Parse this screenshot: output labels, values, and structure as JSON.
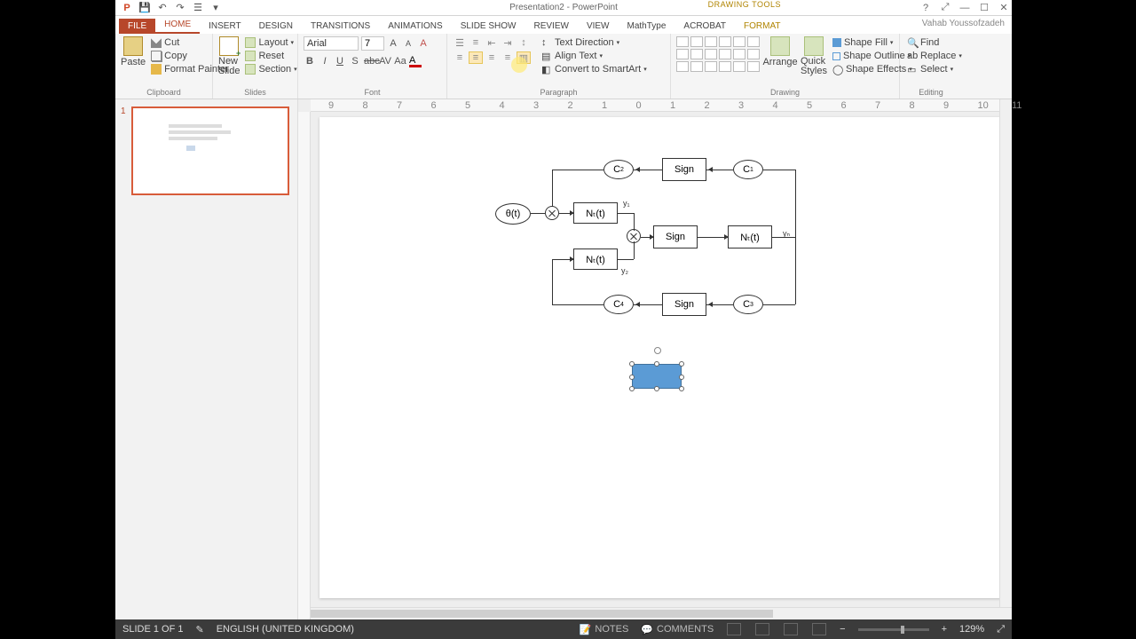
{
  "titlebar": {
    "title": "Presentation2 - PowerPoint",
    "context_tool": "DRAWING TOOLS"
  },
  "tabs": {
    "file": "FILE",
    "home": "HOME",
    "insert": "INSERT",
    "design": "DESIGN",
    "transitions": "TRANSITIONS",
    "animations": "ANIMATIONS",
    "slideshow": "SLIDE SHOW",
    "review": "REVIEW",
    "view": "VIEW",
    "mathtype": "MathType",
    "acrobat": "ACROBAT",
    "format": "FORMAT",
    "user": "Vahab Youssofzadeh"
  },
  "ribbon": {
    "clipboard": {
      "label": "Clipboard",
      "paste": "Paste",
      "cut": "Cut",
      "copy": "Copy",
      "format_painter": "Format Painter"
    },
    "slides": {
      "label": "Slides",
      "new_slide": "New\nSlide",
      "layout": "Layout",
      "reset": "Reset",
      "section": "Section"
    },
    "font": {
      "label": "Font",
      "name": "Arial",
      "size": "7"
    },
    "paragraph": {
      "label": "Paragraph",
      "text_direction": "Text Direction",
      "align_text": "Align Text",
      "smartart": "Convert to SmartArt"
    },
    "drawing": {
      "label": "Drawing",
      "arrange": "Arrange",
      "quick_styles": "Quick\nStyles",
      "shape_fill": "Shape Fill",
      "shape_outline": "Shape Outline",
      "shape_effects": "Shape Effects"
    },
    "editing": {
      "label": "Editing",
      "find": "Find",
      "replace": "Replace",
      "select": "Select"
    }
  },
  "ruler_ticks": [
    "9",
    "8",
    "7",
    "6",
    "5",
    "4",
    "3",
    "2",
    "1",
    "0",
    "1",
    "2",
    "3",
    "4",
    "5",
    "6",
    "7",
    "8",
    "9",
    "10",
    "11"
  ],
  "thumb": {
    "number": "1"
  },
  "diagram": {
    "c1": "C",
    "c1s": "1",
    "c2": "C",
    "c2s": "2",
    "c3": "C",
    "c3s": "3",
    "c4": "C",
    "c4s": "4",
    "sign": "Sign",
    "input": "θ(t)",
    "n_t": "Nₜ(t)",
    "y1": "y₁",
    "y2": "y₂",
    "yn": "yₙ"
  },
  "status": {
    "slide": "SLIDE 1 OF 1",
    "lang": "ENGLISH (UNITED KINGDOM)",
    "notes": "NOTES",
    "comments": "COMMENTS",
    "zoom": "129%"
  }
}
